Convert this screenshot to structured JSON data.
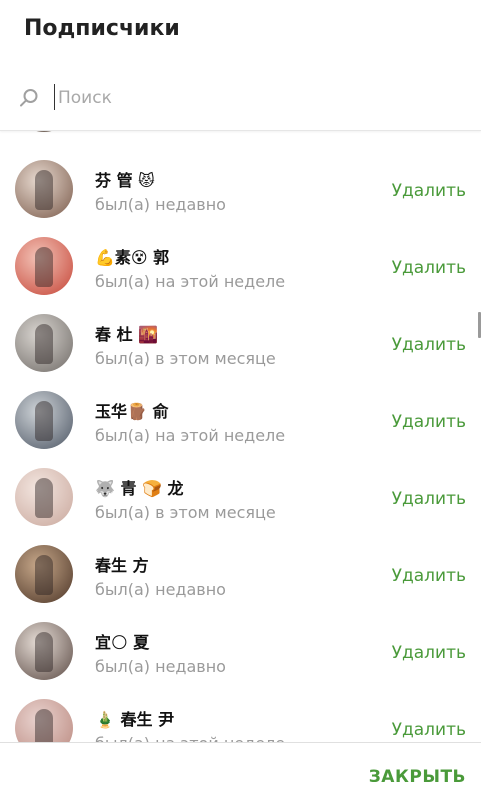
{
  "dialog": {
    "title": "Подписчики"
  },
  "search": {
    "placeholder": "Поиск",
    "value": ""
  },
  "subscribers": [
    {
      "name": "芬 管 😾",
      "status": "был(а) недавно",
      "action": "Удалить",
      "avatar_colors": [
        "#e7d9cf",
        "#7a5a4a"
      ]
    },
    {
      "name": "💪素😵 郭",
      "status": "был(а) на этой неделе",
      "action": "Удалить",
      "avatar_colors": [
        "#f3c3b7",
        "#c54436"
      ]
    },
    {
      "name": "春 杜 🌇",
      "status": "был(а) в этом месяце",
      "action": "Удалить",
      "avatar_colors": [
        "#d9d5d0",
        "#6f6a66"
      ]
    },
    {
      "name": "玉华🪵 俞",
      "status": "был(а) на этой неделе",
      "action": "Удалить",
      "avatar_colors": [
        "#cfd4d8",
        "#4d5664"
      ]
    },
    {
      "name": "🐺 青 🍞 龙",
      "status": "был(а) в этом месяце",
      "action": "Удалить",
      "avatar_colors": [
        "#f3e6e0",
        "#c9a79c"
      ]
    },
    {
      "name": "春生 方",
      "status": "был(а) недавно",
      "action": "Удалить",
      "avatar_colors": [
        "#c7a88a",
        "#4b3426"
      ]
    },
    {
      "name": "宜🌕 夏",
      "status": "был(а) недавно",
      "action": "Удалить",
      "avatar_colors": [
        "#e6ddd6",
        "#5b4a44"
      ]
    },
    {
      "name": "🎍 春生 尹",
      "status": "был(а) на этой неделе",
      "action": "Удалить",
      "avatar_colors": [
        "#e9d3cf",
        "#b9877d"
      ]
    }
  ],
  "footer": {
    "close_label": "ЗАКРЫТЬ"
  },
  "colors": {
    "accent": "#4a9a3a",
    "secondary_text": "#9a9a9a",
    "divider": "#e0e0e0"
  }
}
